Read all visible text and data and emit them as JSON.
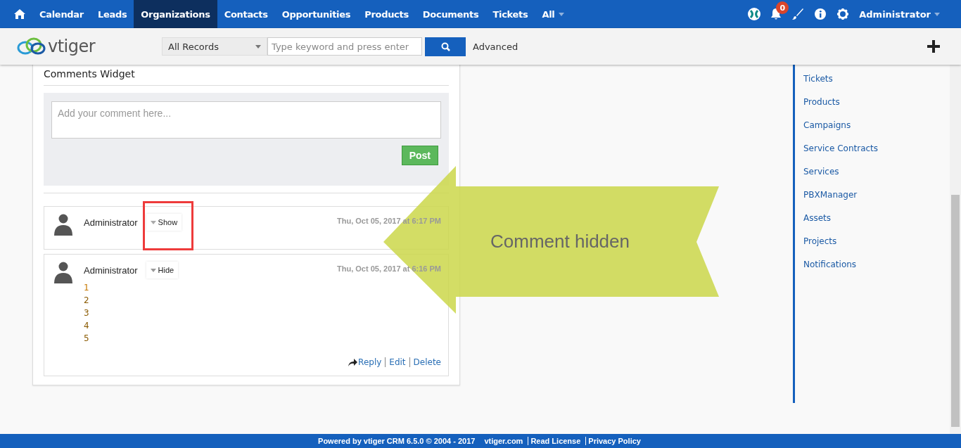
{
  "top_nav": {
    "items": [
      {
        "label": "Calendar",
        "selected": false
      },
      {
        "label": "Leads",
        "selected": false
      },
      {
        "label": "Organizations",
        "selected": true
      },
      {
        "label": "Contacts",
        "selected": false
      },
      {
        "label": "Opportunities",
        "selected": false
      },
      {
        "label": "Products",
        "selected": false
      },
      {
        "label": "Documents",
        "selected": false
      },
      {
        "label": "Tickets",
        "selected": false
      },
      {
        "label": "All",
        "selected": false
      }
    ],
    "notification_count": "0",
    "user": "Administrator"
  },
  "search_bar": {
    "logo": "vtiger",
    "scope": "All Records",
    "placeholder": "Type keyword and press enter",
    "advanced": "Advanced"
  },
  "comments_widget": {
    "title": "Comments Widget",
    "placeholder": "Add your comment here...",
    "post_button": "Post",
    "comments": [
      {
        "author": "Administrator",
        "toggle": "Show",
        "collapsed": true,
        "time": "Thu, Oct 05, 2017 at 6:17 PM"
      },
      {
        "author": "Administrator",
        "toggle": "Hide",
        "collapsed": false,
        "time": "Thu, Oct 05, 2017 at 6:16 PM",
        "lines": [
          "1",
          "2",
          "3",
          "4",
          "5"
        ],
        "actions": [
          "Reply",
          "Edit",
          "Delete"
        ]
      }
    ]
  },
  "related_sidebar": {
    "items": [
      "Tickets",
      "Products",
      "Campaigns",
      "Service Contracts",
      "Services",
      "PBXManager",
      "Assets",
      "Projects",
      "Notifications"
    ]
  },
  "annotation": {
    "label": "Comment hidden"
  },
  "footer": {
    "text": "Powered by vtiger CRM 6.5.0  © 2004 - 2017",
    "links": [
      "vtiger.com",
      "Read License",
      "Privacy Policy"
    ]
  }
}
